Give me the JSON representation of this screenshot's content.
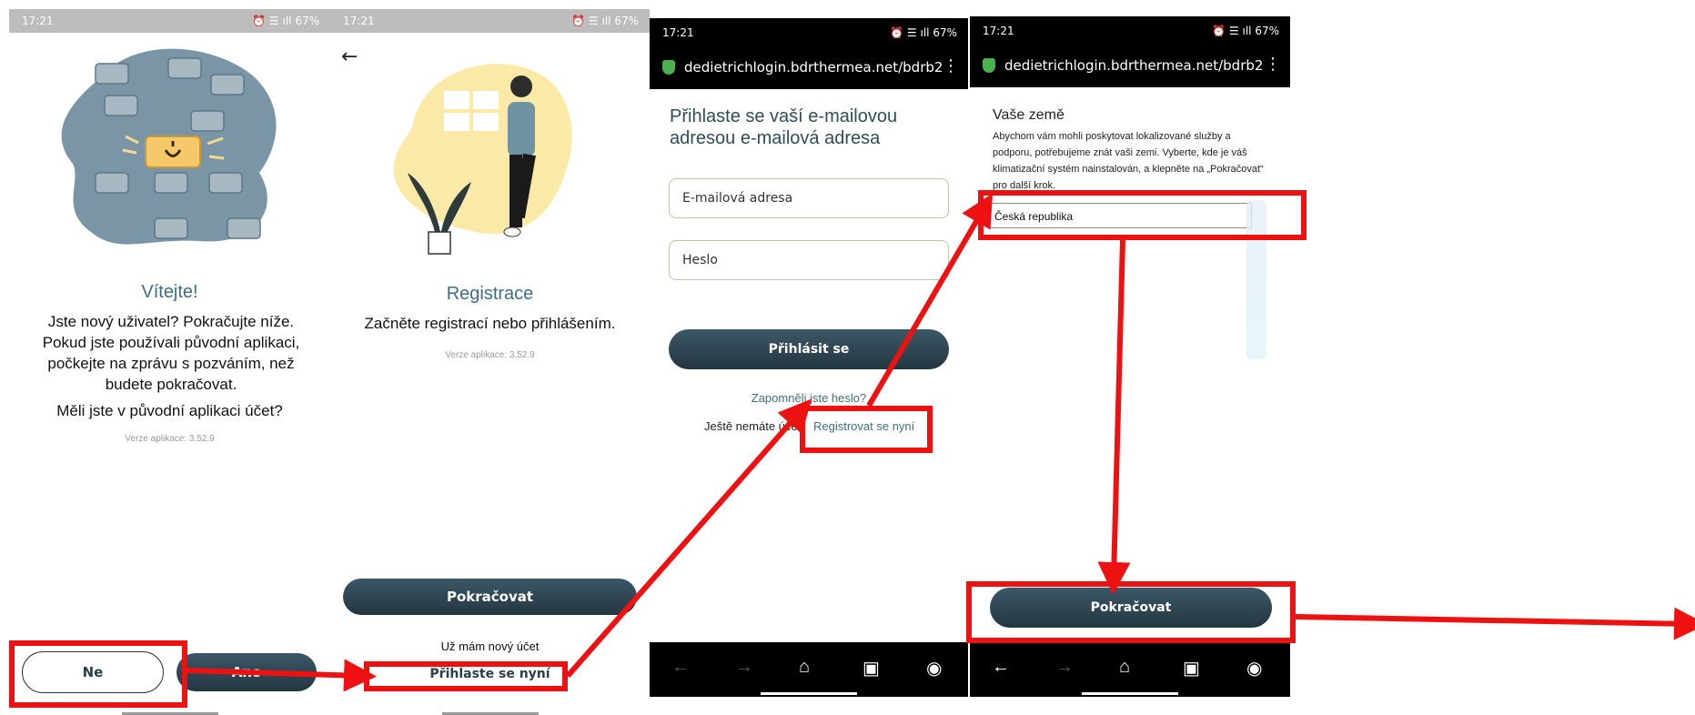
{
  "screens": {
    "welcome": {
      "status_time": "17:21",
      "status_icons": "⏰ ☰ ıll 67%",
      "title": "Vítejte!",
      "message": "Jste nový uživatel? Pokračujte níže. Pokud jste používali původní aplikaci, počkejte na zprávu s pozváním, než budete pokračovat.",
      "question": "Měli jste v původní aplikaci účet?",
      "version": "Verze aplikace: 3.52.9",
      "no_button": "Ne",
      "yes_button": "Ano"
    },
    "registration": {
      "status_time": "17:21",
      "status_icons": "⏰ ☰ ıll 67%",
      "back_icon": "←",
      "title": "Registrace",
      "subtitle": "Začněte registrací nebo přihlášením.",
      "version": "Verze aplikace: 3.52.9",
      "continue_button": "Pokračovat",
      "have_account": "Už mám nový účet",
      "login_link": "Přihlaste se nyní"
    },
    "login": {
      "status_time": "17:21",
      "status_icons": "⏰ ☰ ıll 67%",
      "url": "dedietrichlogin.bdrthermea.net/bdrb2",
      "title": "Přihlaste se vaší e-mailovou adresou e-mailová adresa",
      "email_placeholder": "E-mailová adresa",
      "password_placeholder": "Heslo",
      "login_button": "Přihlásit se",
      "forgot_link": "Zapomněli jste heslo?",
      "no_account": "Ještě nemáte účet",
      "register_link": "Registrovat se nyní"
    },
    "country": {
      "status_time": "17:21",
      "status_icons": "⏰ ☰ ıll 67%",
      "url": "dedietrichlogin.bdrthermea.net/bdrb2",
      "title": "Vaše země",
      "description": "Abychom vám mohli poskytovat lokalizované služby a podporu, potřebujeme znát vaši zemi. Vyberte, kde je váš klimatizační systém nainstalován, a klepněte na „Pokračovat“ pro další krok.",
      "selected_country": "Česká republika",
      "continue_button": "Pokračovat"
    }
  },
  "nav_icons": [
    "back-arrow",
    "forward-arrow",
    "home-icon",
    "tabs-icon",
    "account-icon"
  ],
  "colors": {
    "accent_teal": "#3f6f80",
    "button_dark": "#2b3f49",
    "annotation_red": "#ee1111",
    "blob_blue": "#7a96a6",
    "blob_yellow": "#fbe9a8"
  }
}
